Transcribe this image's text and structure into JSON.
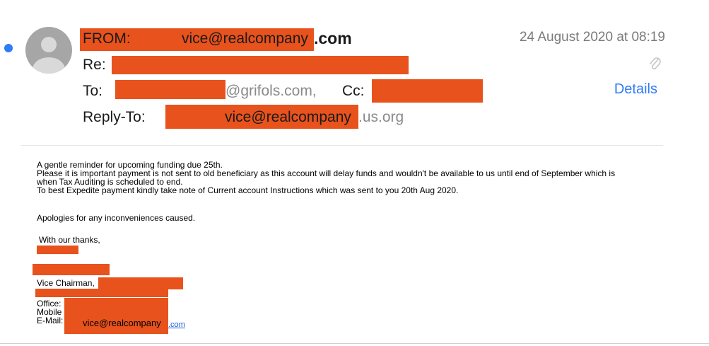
{
  "header": {
    "from_label": "FROM:",
    "from_address": "vice@realcompany",
    "from_suffix": ".com",
    "date": "24 August 2020 at 08:19",
    "re_label": "Re:",
    "to_label": "To:",
    "to_domain": "@grifols.com,",
    "cc_label": "Cc:",
    "details_label": "Details",
    "reply_to_label": "Reply-To:",
    "reply_to_address": "vice@realcompany",
    "reply_to_suffix": ".us.org",
    "icons": [
      "avatar-icon",
      "paperclip-icon"
    ]
  },
  "body": {
    "lines": [
      "A gentle reminder for upcoming funding due 25th.",
      "Please it is important payment is not sent to old beneficiary as this account will delay funds and wouldn't be available to us until end of September which is",
      "when Tax Auditing is scheduled to end.",
      "To best Expedite payment kindly take note of Current account Instructions which was sent to you 20th Aug 2020."
    ],
    "apology": "Apologies for any inconveniences caused.",
    "closing": "With our thanks,",
    "signature": {
      "title": "Vice Chairman,",
      "office_label": "Office:",
      "mobile_label": "Mobile",
      "email_label": "E-Mail:",
      "email_address": "vice@realcompany",
      "email_suffix": ".com"
    }
  },
  "colors": {
    "redaction": "#e8521c",
    "unread_dot": "#2f7cf6",
    "details_link": "#2f7cf6",
    "body_link": "#1a5bd6"
  }
}
